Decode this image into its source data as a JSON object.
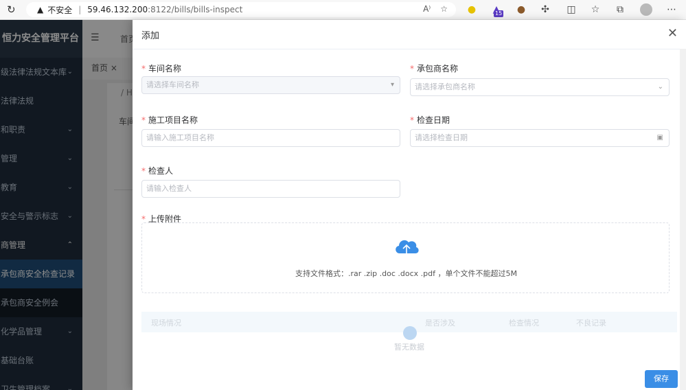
{
  "browser": {
    "security_label": "不安全",
    "url_host": "59.46.132.200",
    "url_path": ":8122/bills/bills-inspect",
    "read_aloud": "A⁾",
    "ext_badge": "15"
  },
  "app": {
    "brand": "恒力安全管理平台",
    "top_first": "首页",
    "tab_home": "首页 ×",
    "crumb": "/ HS",
    "car_label": "车间",
    "menu": [
      {
        "label": "级法律法规文本库",
        "arrow": "⌄"
      },
      {
        "label": "法律法规",
        "arrow": ""
      },
      {
        "label": "和职责",
        "arrow": "⌄"
      },
      {
        "label": "管理",
        "arrow": "⌄"
      },
      {
        "label": "教育",
        "arrow": "⌄"
      },
      {
        "label": "安全与警示标志",
        "arrow": "⌄"
      },
      {
        "label": "商管理",
        "arrow": "⌃"
      },
      {
        "label": "承包商安全检查记录",
        "arrow": ""
      },
      {
        "label": "承包商安全例会",
        "arrow": ""
      },
      {
        "label": "化学品管理",
        "arrow": "⌄"
      },
      {
        "label": "基础台账",
        "arrow": ""
      },
      {
        "label": "卫生管理档案",
        "arrow": "⌄"
      }
    ]
  },
  "drawer": {
    "title": "添加",
    "close": "✕",
    "fields": {
      "workshop": {
        "label": "车间名称",
        "placeholder": "请选择车间名称"
      },
      "contractor": {
        "label": "承包商名称",
        "placeholder": "请选择承包商名称"
      },
      "project": {
        "label": "施工项目名称",
        "placeholder": "请输入施工项目名称"
      },
      "date": {
        "label": "检查日期",
        "placeholder": "请选择检查日期"
      },
      "inspector": {
        "label": "检查人",
        "placeholder": "请输入检查人"
      },
      "attachment": {
        "label": "上传附件"
      }
    },
    "upload_tip": "支持文件格式：.rar .zip .doc .docx .pdf ，单个文件不能超过5M",
    "table_headers": [
      "现场情况",
      "是否涉及",
      "检查情况",
      "不良记录"
    ],
    "empty_text": "暂无数据",
    "save_label": "保存"
  },
  "colors": {
    "accent": "#3a8ee6",
    "required": "#f56c6c",
    "sidebar": "#1f2d3d"
  }
}
